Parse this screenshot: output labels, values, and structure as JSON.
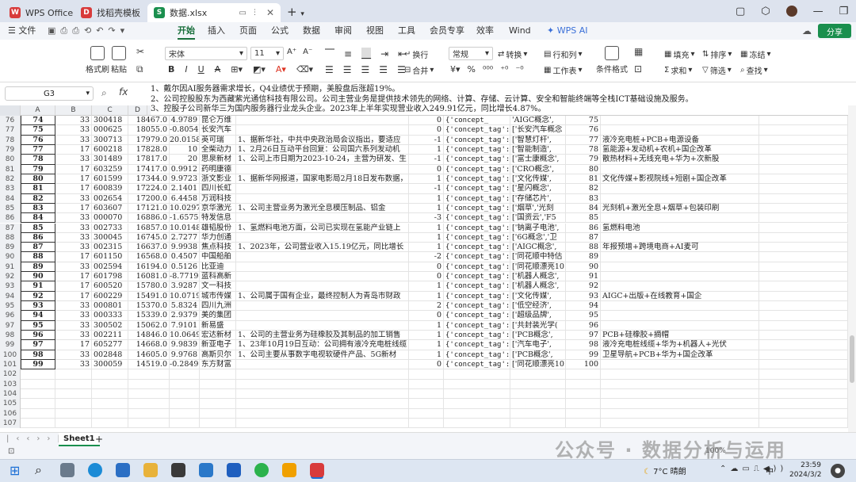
{
  "titlebar": {
    "tabs": [
      {
        "label": "WPS Office",
        "icon": "wps-logo-icon",
        "color": "#d83b3b"
      },
      {
        "label": "找稻壳模板",
        "icon": "docer-icon",
        "color": "#d83b3b"
      },
      {
        "label": "数据.xlsx",
        "icon": "spreadsheet-icon",
        "color": "#1a8f4e"
      }
    ],
    "new_tab": "+"
  },
  "menubar": {
    "file": "文件",
    "items": [
      "开始",
      "插入",
      "页面",
      "公式",
      "数据",
      "审阅",
      "视图",
      "工具",
      "会员专享",
      "效率",
      "Wind"
    ],
    "active": "开始",
    "wps_ai": "WPS AI",
    "share": "分享"
  },
  "ribbon": {
    "format_painter": "格式刷",
    "paste": "粘贴",
    "font_name": "宋体",
    "font_size": "11",
    "wrap": "换行",
    "merge": "合并",
    "number_format": "常规",
    "convert": "转换",
    "rows_cols": "行和列",
    "worksheet": "工作表",
    "cond_format": "条件格式",
    "fill": "填充",
    "sort": "排序",
    "freeze": "冻结",
    "sum": "求和",
    "filter": "筛选",
    "find": "查找"
  },
  "formula_bar": {
    "cell_ref": "G3",
    "lines": [
      "1、戴尔因AI服务器需求增长，Q4业绩优于预期，美股盘后涨超19%。",
      "2、公司控股股东为西藏紫光通信科技有限公司。公司主营业务是提供技术领先的网络、计算、存储、云计算、安全和智能终端等全栈ICT基础设施及服务。",
      "3、控股子公司新华三为国内服务器行业龙头企业。2023年上半年实现营业收入249.91亿元，同比增长4.87%。"
    ]
  },
  "columns": [
    "A",
    "B",
    "C",
    "D"
  ],
  "rows": [
    {
      "n": "76",
      "a": "74",
      "b": "33",
      "c": "300418",
      "d": "18467.0",
      "e": "4.9789",
      "f": "昆仑万维",
      "g": "",
      "h": "0",
      "i": "{'concept_",
      "j": "'AIGC概念',",
      "k": "75",
      "l": ""
    },
    {
      "n": "77",
      "a": "75",
      "b": "33",
      "c": "000625",
      "d": "18055.0",
      "e": "-0.8054",
      "f": "长安汽车",
      "g": "",
      "h": "0",
      "i": "{'concept_tag':",
      "j": "['长安汽车概念",
      "k": "76",
      "l": ""
    },
    {
      "n": "78",
      "a": "76",
      "b": "33",
      "c": "300713",
      "d": "17979.0",
      "e": "20.0158",
      "f": "英可瑞",
      "g": "1、据新华社，中共中央政治局会议指出，要适应",
      "h": "-1",
      "i": "{'concept_tag':",
      "j": "['智慧灯杆',",
      "k": "77",
      "l": "液冷充电桩+PCB+电源设备"
    },
    {
      "n": "79",
      "a": "77",
      "b": "17",
      "c": "600218",
      "d": "17828.0",
      "e": "10",
      "f": "全柴动力",
      "g": "1、2月26日互动平台回复：公司国六系列发动机",
      "h": "1",
      "i": "{'concept_tag':",
      "j": "['智能制造',",
      "k": "78",
      "l": "氢能源+发动机+农机+国企改革"
    },
    {
      "n": "80",
      "a": "78",
      "b": "33",
      "c": "301489",
      "d": "17817.0",
      "e": "20",
      "f": "思泉新材",
      "g": "1、公司上市日期为2023-10-24，主营为研发、生",
      "h": "-1",
      "i": "{'concept_tag':",
      "j": "['富士康概念',",
      "k": "79",
      "l": "散热材料+无线充电+华为+次新股"
    },
    {
      "n": "81",
      "a": "79",
      "b": "17",
      "c": "603259",
      "d": "17417.0",
      "e": "0.9912",
      "f": "药明康德",
      "g": "",
      "h": "0",
      "i": "{'concept_tag':",
      "j": "['CRO概念',",
      "k": "80",
      "l": ""
    },
    {
      "n": "82",
      "a": "80",
      "b": "17",
      "c": "601599",
      "d": "17344.0",
      "e": "9.9723",
      "f": "浙文影业",
      "g": "1、据新华网报道，国家电影局2月18日发布数据，",
      "h": "1",
      "i": "{'concept_tag':",
      "j": "['文化传媒',",
      "k": "81",
      "l": "文化传媒+影视院线+短剧+国企改革"
    },
    {
      "n": "83",
      "a": "81",
      "b": "17",
      "c": "600839",
      "d": "17224.0",
      "e": "2.1401",
      "f": "四川长虹",
      "g": "",
      "h": "-1",
      "i": "{'concept_tag':",
      "j": "['星闪概念',",
      "k": "82",
      "l": ""
    },
    {
      "n": "84",
      "a": "82",
      "b": "33",
      "c": "002654",
      "d": "17200.0",
      "e": "6.4458",
      "f": "万润科技",
      "g": "",
      "h": "1",
      "i": "{'concept_tag':",
      "j": "['存储芯片',",
      "k": "83",
      "l": ""
    },
    {
      "n": "85",
      "a": "83",
      "b": "17",
      "c": "603607",
      "d": "17121.0",
      "e": "10.0297",
      "f": "京华激光",
      "g": "1、公司主营业务为激光全息模压制品、铝金",
      "h": "1",
      "i": "{'concept_tag':",
      "j": "['烟草','光刻",
      "k": "84",
      "l": "光刻机+激光全息+烟草+包装印刷"
    },
    {
      "n": "86",
      "a": "84",
      "b": "33",
      "c": "000070",
      "d": "16886.0",
      "e": "-1.6575",
      "f": "特发信息",
      "g": "",
      "h": "-3",
      "i": "{'concept_tag':",
      "j": "['国资云','F5",
      "k": "85",
      "l": ""
    },
    {
      "n": "87",
      "a": "85",
      "b": "33",
      "c": "002733",
      "d": "16857.0",
      "e": "10.0148",
      "f": "雄韬股份",
      "g": "1、氢燃料电池方面，公司已实现在氢能产业链上",
      "h": "1",
      "i": "{'concept_tag':",
      "j": "['钠离子电池',",
      "k": "86",
      "l": "氢燃料电池"
    },
    {
      "n": "88",
      "a": "86",
      "b": "33",
      "c": "300045",
      "d": "16745.0",
      "e": "2.7277",
      "f": "华力创通",
      "g": "",
      "h": "1",
      "i": "{'concept_tag':",
      "j": "['6G概念','卫",
      "k": "87",
      "l": ""
    },
    {
      "n": "89",
      "a": "87",
      "b": "33",
      "c": "002315",
      "d": "16637.0",
      "e": "9.9938",
      "f": "焦点科技",
      "g": "1、2023年，公司营业收入15.19亿元，同比增长",
      "h": "1",
      "i": "{'concept_tag':",
      "j": "['AIGC概念',",
      "k": "88",
      "l": "年报预增+跨境电商+AI麦可"
    },
    {
      "n": "90",
      "a": "88",
      "b": "17",
      "c": "601150",
      "d": "16568.0",
      "e": "0.4507",
      "f": "中国船舶",
      "g": "",
      "h": "-2",
      "i": "{'concept_tag':",
      "j": "['同花顺中特估",
      "k": "89",
      "l": ""
    },
    {
      "n": "91",
      "a": "89",
      "b": "33",
      "c": "002594",
      "d": "16194.0",
      "e": "0.5126",
      "f": "比亚迪",
      "g": "",
      "h": "0",
      "i": "{'concept_tag':",
      "j": "['同花顺漂亮10",
      "k": "90",
      "l": ""
    },
    {
      "n": "92",
      "a": "90",
      "b": "17",
      "c": "601798",
      "d": "16081.0",
      "e": "-8.7719",
      "f": "蓝科高新",
      "g": "",
      "h": "0",
      "i": "{'concept_tag':",
      "j": "['机器人概念',",
      "k": "91",
      "l": ""
    },
    {
      "n": "93",
      "a": "91",
      "b": "17",
      "c": "600520",
      "d": "15780.0",
      "e": "3.9287",
      "f": "文一科技",
      "g": "",
      "h": "1",
      "i": "{'concept_tag':",
      "j": "['机器人概念',",
      "k": "92",
      "l": ""
    },
    {
      "n": "94",
      "a": "92",
      "b": "17",
      "c": "600229",
      "d": "15491.0",
      "e": "10.0719",
      "f": "城市传媒",
      "g": "1、公司属于国有企业，最终控制人为青岛市财政",
      "h": "1",
      "i": "{'concept_tag':",
      "j": "['文化传媒',",
      "k": "93",
      "l": "AIGC+出版+在线教育+国企"
    },
    {
      "n": "95",
      "a": "93",
      "b": "33",
      "c": "000801",
      "d": "15370.0",
      "e": "5.8324",
      "f": "四川九洲",
      "g": "",
      "h": "2",
      "i": "{'concept_tag':",
      "j": "['低空经济',",
      "k": "94",
      "l": ""
    },
    {
      "n": "96",
      "a": "94",
      "b": "33",
      "c": "000333",
      "d": "15339.0",
      "e": "2.9379",
      "f": "美的集团",
      "g": "",
      "h": "0",
      "i": "{'concept_tag':",
      "j": "['超级品牌',",
      "k": "95",
      "l": ""
    },
    {
      "n": "97",
      "a": "95",
      "b": "33",
      "c": "300502",
      "d": "15062.0",
      "e": "7.9101",
      "f": "新易盛",
      "g": "",
      "h": "1",
      "i": "{'concept_tag':",
      "j": "['共封装光学(",
      "k": "96",
      "l": ""
    },
    {
      "n": "98",
      "a": "96",
      "b": "33",
      "c": "002211",
      "d": "14846.0",
      "e": "10.0649",
      "f": "宏达新材",
      "g": "1、公司的主营业务为硅橡胶及其制品的加工销售",
      "h": "1",
      "i": "{'concept_tag':",
      "j": "['PCB概念',",
      "k": "97",
      "l": "PCB+硅橡胶+摘帽"
    },
    {
      "n": "99",
      "a": "97",
      "b": "17",
      "c": "605277",
      "d": "14668.0",
      "e": "9.9839",
      "f": "新亚电子",
      "g": "1、23年10月19日互动：公司拥有液冷充电桩线缆",
      "h": "1",
      "i": "{'concept_tag':",
      "j": "['汽车电子',",
      "k": "98",
      "l": "液冷充电桩线缆+华为+机器人+光伏"
    },
    {
      "n": "100",
      "a": "98",
      "b": "33",
      "c": "002848",
      "d": "14605.0",
      "e": "9.9768",
      "f": "高斯贝尔",
      "g": "1、公司主要从事数字电视软硬件产品、5G新材",
      "h": "1",
      "i": "{'concept_tag':",
      "j": "['PCB概念',",
      "k": "99",
      "l": "卫星导航+PCB+华为+国企改革"
    },
    {
      "n": "101",
      "a": "99",
      "b": "33",
      "c": "300059",
      "d": "14519.0",
      "e": "-0.2849",
      "f": "东方财富",
      "g": "",
      "h": "0",
      "i": "{'concept_tag':",
      "j": "['同花顺漂亮10",
      "k": "100",
      "l": ""
    },
    {
      "n": "102",
      "a": "",
      "b": "",
      "c": "",
      "d": "",
      "e": "",
      "f": "",
      "g": "",
      "h": "",
      "i": "",
      "j": "",
      "k": "",
      "l": ""
    },
    {
      "n": "103",
      "a": "",
      "b": "",
      "c": "",
      "d": "",
      "e": "",
      "f": "",
      "g": "",
      "h": "",
      "i": "",
      "j": "",
      "k": "",
      "l": ""
    },
    {
      "n": "104",
      "a": "",
      "b": "",
      "c": "",
      "d": "",
      "e": "",
      "f": "",
      "g": "",
      "h": "",
      "i": "",
      "j": "",
      "k": "",
      "l": ""
    },
    {
      "n": "105",
      "a": "",
      "b": "",
      "c": "",
      "d": "",
      "e": "",
      "f": "",
      "g": "",
      "h": "",
      "i": "",
      "j": "",
      "k": "",
      "l": ""
    },
    {
      "n": "106",
      "a": "",
      "b": "",
      "c": "",
      "d": "",
      "e": "",
      "f": "",
      "g": "",
      "h": "",
      "i": "",
      "j": "",
      "k": "",
      "l": ""
    },
    {
      "n": "107",
      "a": "",
      "b": "",
      "c": "",
      "d": "",
      "e": "",
      "f": "",
      "g": "",
      "h": "",
      "i": "",
      "j": "",
      "k": "",
      "l": ""
    }
  ],
  "sheet": {
    "tab": "Sheet1",
    "add": "+"
  },
  "status": {
    "zoom": "100%"
  },
  "watermark": "公众号 · 数据分析与运用",
  "taskbar": {
    "weather": "7°C 晴朗",
    "ime": "中",
    "time": "23:59",
    "date": "2024/3/2"
  }
}
